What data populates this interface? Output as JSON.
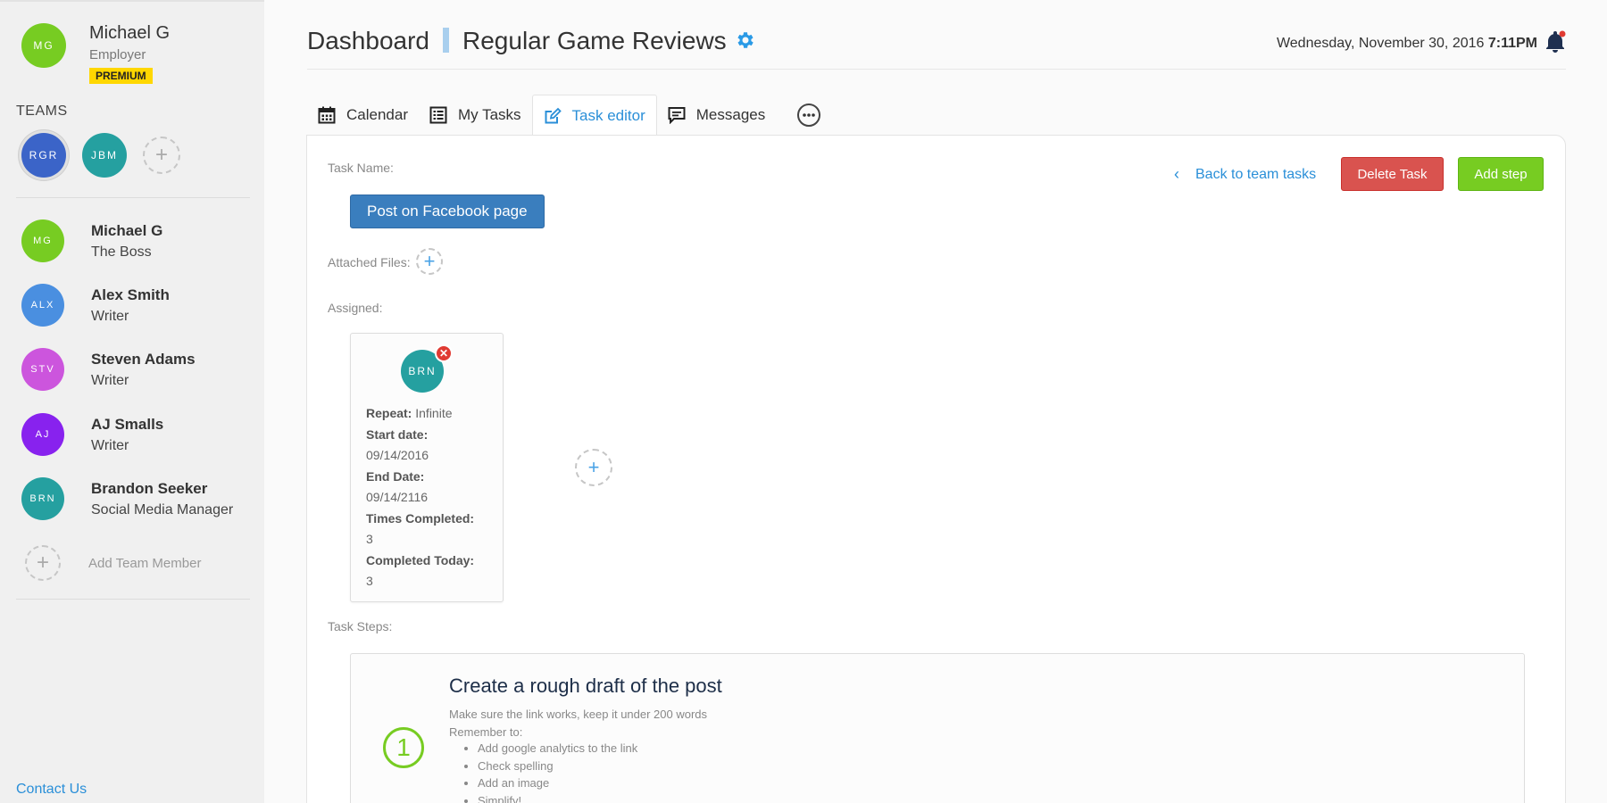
{
  "user": {
    "initials": "MG",
    "name": "Michael G",
    "role": "Employer",
    "badge": "PREMIUM",
    "color": "#77cc22"
  },
  "teams": {
    "title": "TEAMS",
    "items": [
      {
        "initials": "RGR",
        "color": "#3b64c8",
        "selected": true
      },
      {
        "initials": "JBM",
        "color": "#25a0a0",
        "selected": false
      }
    ]
  },
  "members": [
    {
      "initials": "MG",
      "name": "Michael G",
      "role": "The Boss",
      "color": "#77cc22"
    },
    {
      "initials": "ALX",
      "name": "Alex Smith",
      "role": "Writer",
      "color": "#4a8fe0"
    },
    {
      "initials": "STV",
      "name": "Steven Adams",
      "role": "Writer",
      "color": "#cc55dd"
    },
    {
      "initials": "AJ",
      "name": "AJ Smalls",
      "role": "Writer",
      "color": "#8822ee"
    },
    {
      "initials": "BRN",
      "name": "Brandon Seeker",
      "role": "Social Media Manager",
      "color": "#25a0a0"
    }
  ],
  "add_member_label": "Add Team Member",
  "contact_label": "Contact Us",
  "header": {
    "title": "Dashboard",
    "board": "Regular Game Reviews",
    "date": "Wednesday, November 30, 2016",
    "time": "7:11PM"
  },
  "tabs": [
    {
      "label": "Calendar",
      "icon": "calendar-icon",
      "active": false
    },
    {
      "label": "My Tasks",
      "icon": "tasks-icon",
      "active": false
    },
    {
      "label": "Task editor",
      "icon": "edit-icon",
      "active": true
    },
    {
      "label": "Messages",
      "icon": "messages-icon",
      "active": false
    }
  ],
  "task": {
    "name_label": "Task Name:",
    "name": "Post on Facebook page",
    "attached_label": "Attached Files:",
    "assigned_label": "Assigned:",
    "back_label": "Back to team tasks",
    "delete_label": "Delete Task",
    "add_step_label": "Add step",
    "assignee": {
      "initials": "BRN",
      "repeat_label": "Repeat:",
      "repeat": "Infinite",
      "start_label": "Start date:",
      "start": "09/14/2016",
      "end_label": "End Date:",
      "end": "09/14/2116",
      "times_label": "Times Completed:",
      "times": "3",
      "today_label": "Completed Today:",
      "today": "3"
    },
    "steps_label": "Task Steps:",
    "steps": [
      {
        "number": "1",
        "title": "Create a rough draft of the post",
        "desc": "Make sure the link works, keep it under 200 words",
        "remember": "Remember to:",
        "items": [
          "Add google analytics to the link",
          "Check spelling",
          "Add an image",
          "Simplify!"
        ]
      }
    ]
  },
  "colors": {
    "accent": "#2a8fd8",
    "danger": "#d9534f",
    "success": "#77cc22",
    "chip": "#3a7ebe"
  }
}
